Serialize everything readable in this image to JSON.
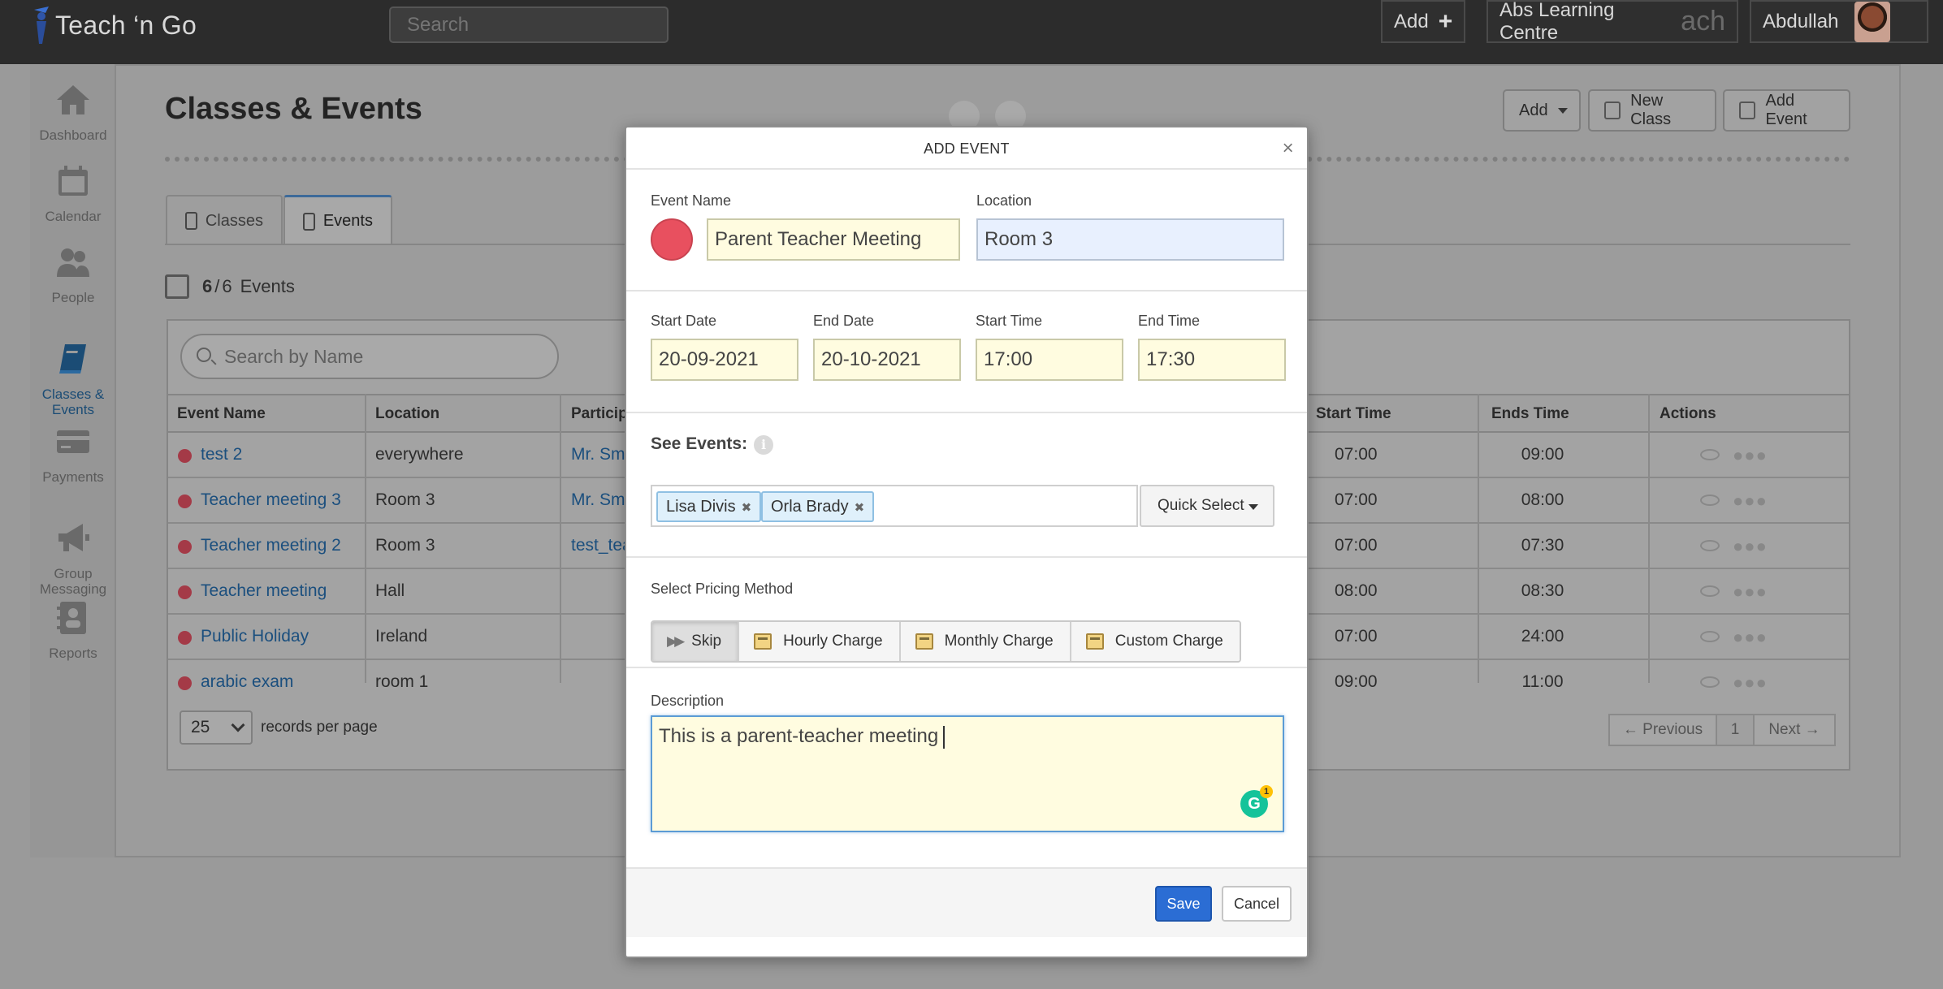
{
  "app": {
    "brand": "Teach ‘n Go",
    "search_placeholder": "Search",
    "add_label": "Add",
    "centre_name": "Abs Learning Centre",
    "centre_ghost": "ach",
    "user_name": "Abdullah"
  },
  "sidebar": {
    "items": [
      {
        "label": "Dashboard"
      },
      {
        "label": "Calendar"
      },
      {
        "label": "People"
      },
      {
        "label": "Classes &\nEvents"
      },
      {
        "label": "Payments"
      },
      {
        "label": "Group\nMessaging"
      },
      {
        "label": "Reports"
      }
    ]
  },
  "page": {
    "title": "Classes & Events",
    "buttons": {
      "add": "Add",
      "new_class": "New Class",
      "add_event": "Add Event"
    },
    "tabs": {
      "classes": "Classes",
      "events": "Events"
    },
    "count_shown": "6",
    "count_sep": "/",
    "count_total": "6",
    "count_label": "Events",
    "table_search_placeholder": "Search by Name",
    "columns": {
      "event_name": "Event Name",
      "location": "Location",
      "participants": "Particip",
      "start_time": "Start Time",
      "ends_time": "Ends Time",
      "actions": "Actions"
    },
    "rows": [
      {
        "name": "test 2",
        "location": "everywhere",
        "participants": "Mr. Smi",
        "start": "07:00",
        "end": "09:00"
      },
      {
        "name": "Teacher meeting 3",
        "location": "Room 3",
        "participants": "Mr. Smi",
        "start": "07:00",
        "end": "08:00"
      },
      {
        "name": "Teacher meeting 2",
        "location": "Room 3",
        "participants": "test_tea",
        "start": "07:00",
        "end": "07:30"
      },
      {
        "name": "Teacher meeting",
        "location": "Hall",
        "participants": "",
        "start": "08:00",
        "end": "08:30"
      },
      {
        "name": "Public Holiday",
        "location": "Ireland",
        "participants": "",
        "start": "07:00",
        "end": "24:00"
      },
      {
        "name": "arabic exam",
        "location": "room 1",
        "participants": "",
        "start": "09:00",
        "end": "11:00"
      }
    ],
    "per_page": "25",
    "per_page_label": "records per page",
    "pager": {
      "prev": "← Previous",
      "page": "1",
      "next": "Next →"
    }
  },
  "modal": {
    "title": "ADD EVENT",
    "close": "×",
    "event_name_label": "Event Name",
    "event_name_value": "Parent Teacher Meeting",
    "event_color": "#e8505f",
    "location_label": "Location",
    "location_value": "Room 3",
    "start_date_label": "Start Date",
    "start_date_value": "20-09-2021",
    "end_date_label": "End Date",
    "end_date_value": "20-10-2021",
    "start_time_label": "Start Time",
    "start_time_value": "17:00",
    "end_time_label": "End Time",
    "end_time_value": "17:30",
    "see_events_label": "See Events:",
    "info_glyph": "i",
    "tags": [
      "Lisa Divis",
      "Orla Brady"
    ],
    "quick_select": "Quick Select",
    "pricing_label": "Select Pricing Method",
    "pricing_options": [
      "Skip",
      "Hourly Charge",
      "Monthly Charge",
      "Custom Charge"
    ],
    "description_label": "Description",
    "description_value": "This is a parent-teacher meeting",
    "grammarly_letter": "G",
    "grammarly_count": "1",
    "save": "Save",
    "cancel": "Cancel"
  },
  "colors": {
    "primary_button": "#2b6dd4",
    "link": "#1b4f7e",
    "event_dot": "#e8505f",
    "input_fill": "#fffce0"
  }
}
